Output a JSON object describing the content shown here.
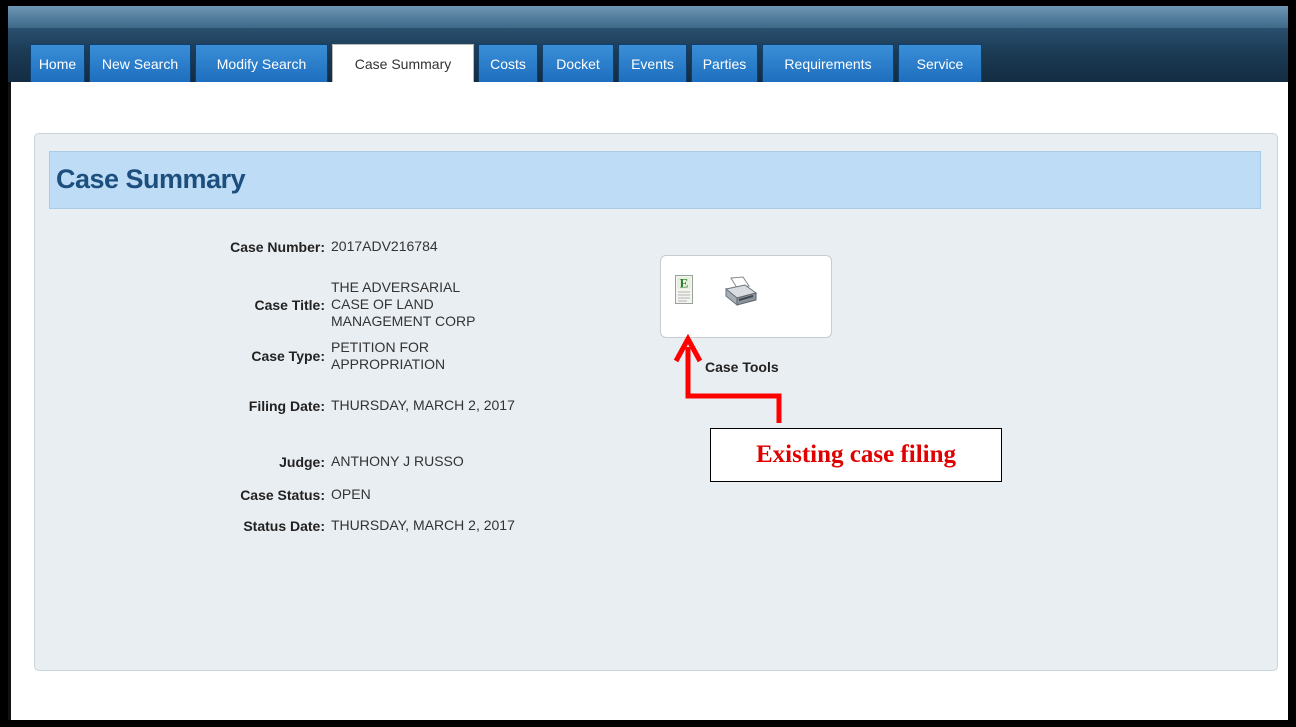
{
  "tabs": [
    {
      "label": "Home",
      "active": false
    },
    {
      "label": "New Search",
      "active": false
    },
    {
      "label": "Modify Search",
      "active": false
    },
    {
      "label": "Case Summary",
      "active": true
    },
    {
      "label": "Costs",
      "active": false
    },
    {
      "label": "Docket",
      "active": false
    },
    {
      "label": "Events",
      "active": false
    },
    {
      "label": "Parties",
      "active": false
    },
    {
      "label": "Requirements",
      "active": false
    },
    {
      "label": "Service",
      "active": false
    }
  ],
  "panel": {
    "title": "Case Summary"
  },
  "fields": {
    "case_number": {
      "label": "Case Number:",
      "value": "2017ADV216784"
    },
    "case_title": {
      "label": "Case Title:",
      "value": "THE ADVERSARIAL CASE OF LAND MANAGEMENT CORP"
    },
    "case_type": {
      "label": "Case Type:",
      "value": "PETITION FOR APPROPRIATION"
    },
    "filing_date": {
      "label": "Filing Date:",
      "value": "THURSDAY, MARCH 2, 2017"
    },
    "judge": {
      "label": "Judge:",
      "value": "ANTHONY J RUSSO"
    },
    "case_status": {
      "label": "Case Status:",
      "value": "OPEN"
    },
    "status_date": {
      "label": "Status Date:",
      "value": "THURSDAY, MARCH 2, 2017"
    }
  },
  "case_tools": {
    "label": "Case Tools",
    "icons": [
      "efile-icon",
      "printer-icon"
    ]
  },
  "annotation": {
    "text": "Existing case filing",
    "color": "#e00000"
  },
  "colors": {
    "tab_blue": "#1e6fbf",
    "header_band": "#bedcf6",
    "title_text": "#1d4f7e",
    "panel_bg": "#e9eef2"
  }
}
